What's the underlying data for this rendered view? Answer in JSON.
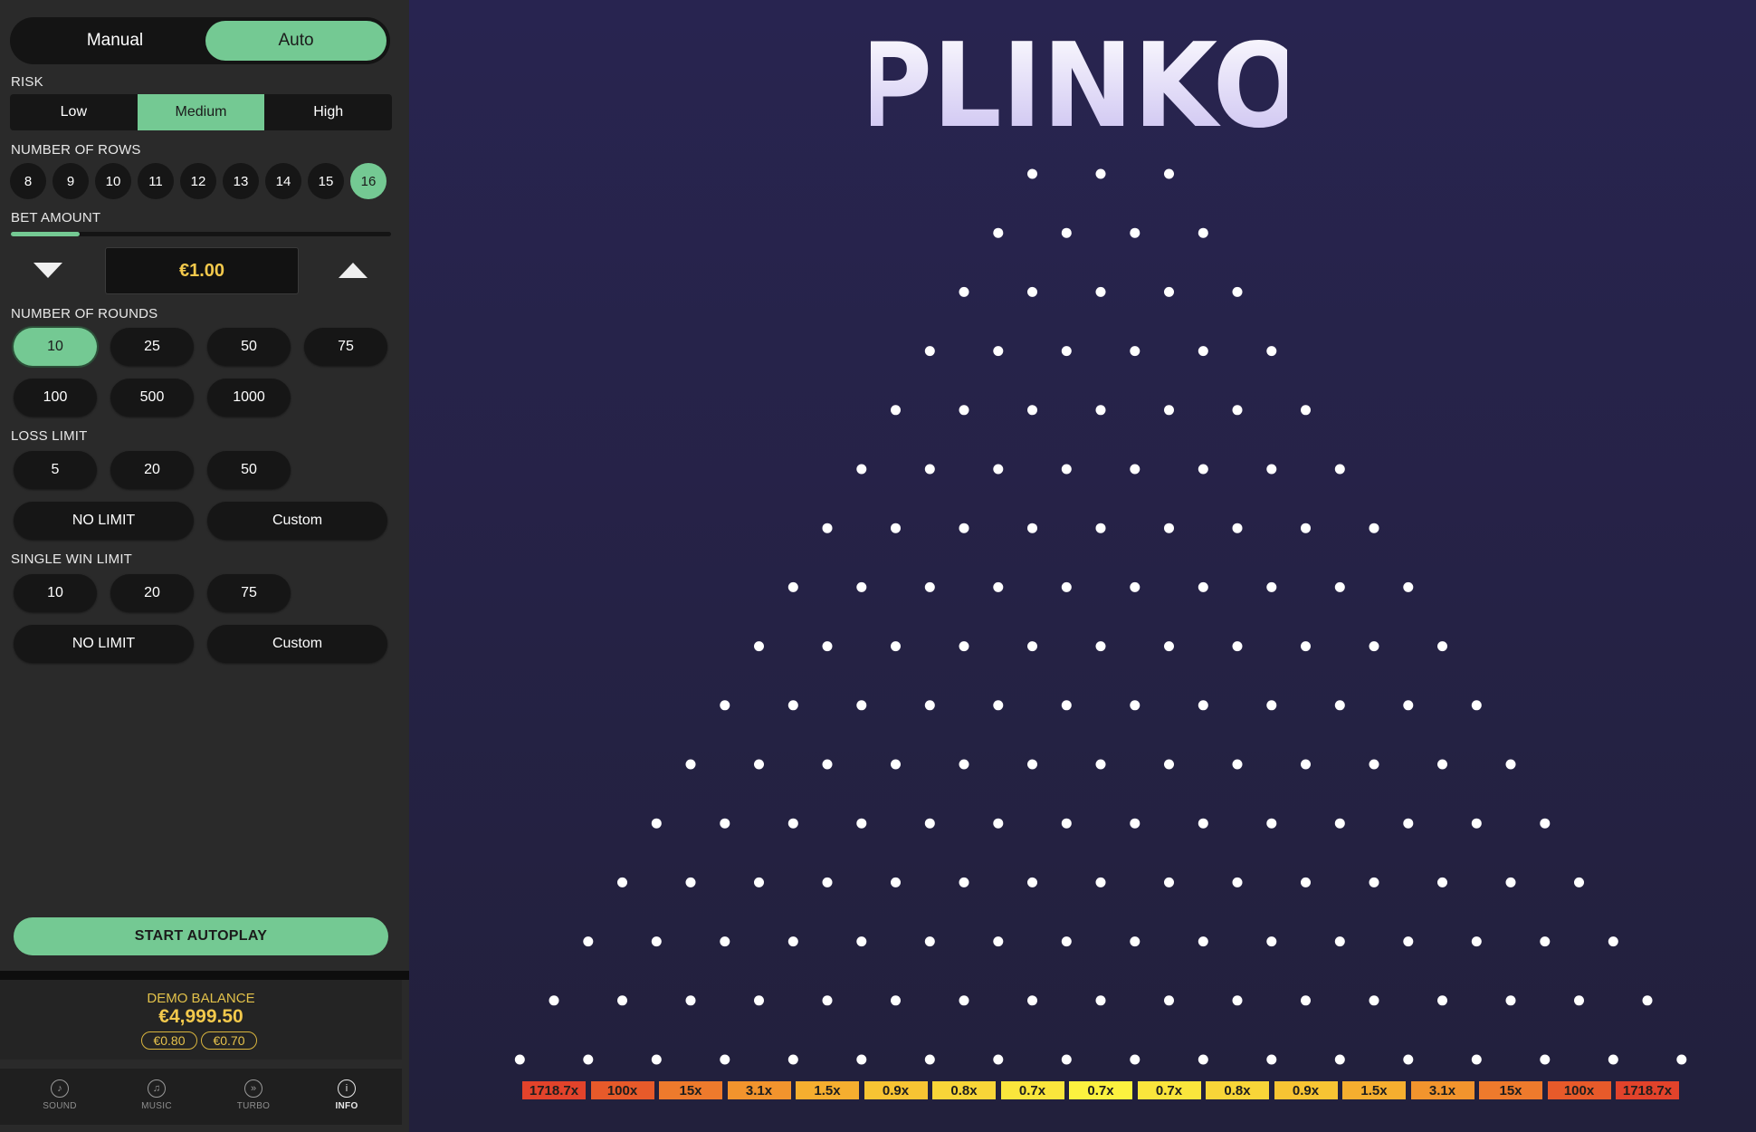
{
  "mode_toggle": {
    "manual_label": "Manual",
    "auto_label": "Auto",
    "selected": "Auto"
  },
  "risk": {
    "label": "RISK",
    "options": [
      "Low",
      "Medium",
      "High"
    ],
    "selected": "Medium"
  },
  "rows": {
    "label": "NUMBER OF ROWS",
    "options": [
      "8",
      "9",
      "10",
      "11",
      "12",
      "13",
      "14",
      "15",
      "16"
    ],
    "selected": "16"
  },
  "bet": {
    "label": "BET AMOUNT",
    "value": "€1.00",
    "slider_fraction": 0.18
  },
  "rounds": {
    "label": "NUMBER OF ROUNDS",
    "options": [
      "10",
      "25",
      "50",
      "75",
      "100",
      "500",
      "1000"
    ],
    "selected": "10"
  },
  "loss_limit": {
    "label": "LOSS LIMIT",
    "options": [
      "5",
      "20",
      "50"
    ],
    "no_limit_label": "NO LIMIT",
    "custom_label": "Custom"
  },
  "single_win_limit": {
    "label": "SINGLE WIN LIMIT",
    "options": [
      "10",
      "20",
      "75"
    ],
    "no_limit_label": "NO LIMIT",
    "custom_label": "Custom"
  },
  "start_button_label": "START AUTOPLAY",
  "balance": {
    "label": "DEMO BALANCE",
    "value": "€4,999.50",
    "last_wins": [
      "€0.80",
      "€0.70"
    ]
  },
  "nav": [
    {
      "label": "SOUND",
      "icon": "sound-icon"
    },
    {
      "label": "MUSIC",
      "icon": "music-icon"
    },
    {
      "label": "TURBO",
      "icon": "turbo-icon"
    },
    {
      "label": "INFO",
      "icon": "info-icon",
      "active": true
    }
  ],
  "game": {
    "title": "PLINKO",
    "peg_rows": 16,
    "multipliers": [
      "1718.7x",
      "100x",
      "15x",
      "3.1x",
      "1.5x",
      "0.9x",
      "0.8x",
      "0.7x",
      "0.7x",
      "0.7x",
      "0.8x",
      "0.9x",
      "1.5x",
      "3.1x",
      "15x",
      "100x",
      "1718.7x"
    ],
    "bucket_colors": [
      "#e2432b",
      "#e75a2a",
      "#ee7a2c",
      "#f2942d",
      "#f5ae2f",
      "#f7c433",
      "#f8d538",
      "#fae53c",
      "#fcf23f",
      "#fae53c",
      "#f8d538",
      "#f7c433",
      "#f5ae2f",
      "#f2942d",
      "#ee7a2c",
      "#e75a2a",
      "#e2432b"
    ],
    "accent": "#74c993",
    "gold": "#f3c94c"
  }
}
